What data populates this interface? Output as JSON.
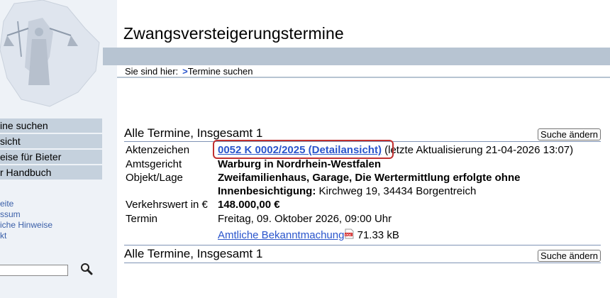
{
  "header": {
    "title": "Zwangsversteigerungstermine",
    "breadcrumb_label": "Sie sind hier:",
    "breadcrumb_arrow": ">",
    "breadcrumb_current": "Termine suchen"
  },
  "sidebar": {
    "items": [
      {
        "label": "ine suchen"
      },
      {
        "label": "sicht"
      },
      {
        "label": "eise für Bieter"
      },
      {
        "label": "r Handbuch"
      }
    ],
    "links": [
      {
        "label": "eite"
      },
      {
        "label": "ssum"
      },
      {
        "label": "iche Hinweise"
      },
      {
        "label": "kt"
      }
    ],
    "search_value": ""
  },
  "results": {
    "heading_top": "Alle Termine, Insgesamt 1",
    "heading_bottom": "Alle Termine, Insgesamt 1",
    "button_label": "Suche ändern",
    "record": {
      "aktenzeichen_label": "Aktenzeichen",
      "aktenzeichen_value": "0052 K 0002/2025 (Detailansicht)",
      "update_note": "(letzte Aktualisierung 21-04-2026 13:07)",
      "amtsgericht_label": "Amtsgericht",
      "amtsgericht_value": "Warburg in Nordrhein-Westfalen",
      "objekt_label": "Objekt/Lage",
      "objekt_line1": "Zweifamilienhaus, Garage, Die Wertermittlung erfolgte ohne",
      "objekt_line2_bold": "Innenbesichtigung:",
      "objekt_address": "Kirchweg 19, 34434 Borgentreich",
      "verkehrswert_label": "Verkehrswert in €",
      "verkehrswert_value": "148.000,00 €",
      "termin_label": "Termin",
      "termin_value": "Freitag, 09. Oktober 2026, 09:00 Uhr",
      "bekanntmachung_label": "Amtliche Bekanntmachung",
      "bekanntmachung_size": "71.33 kB"
    }
  },
  "colors": {
    "link": "#2a55cc",
    "header_band": "#b7c4d2",
    "nav_bg": "#c5d1dd",
    "highlight": "#c03030"
  }
}
